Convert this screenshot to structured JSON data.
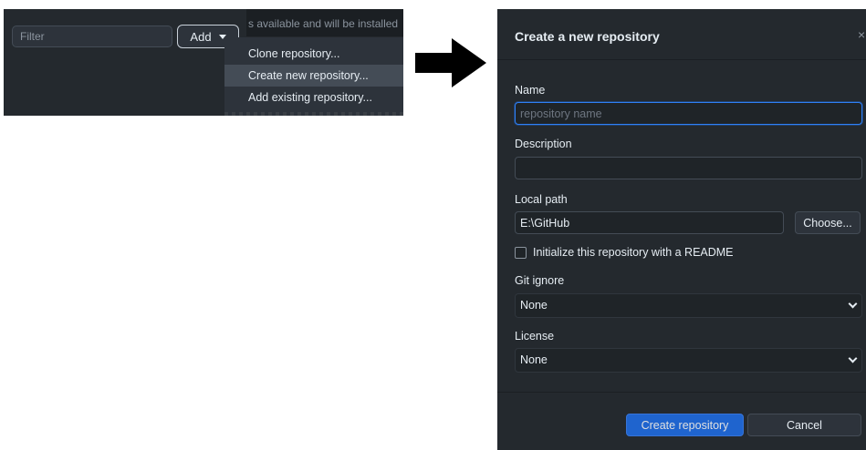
{
  "left": {
    "filter_placeholder": "Filter",
    "add_button_label": "Add",
    "banner_text": "s available and will be installed",
    "menu_items": [
      {
        "label": "Clone repository..."
      },
      {
        "label": "Create new repository..."
      },
      {
        "label": "Add existing repository..."
      }
    ]
  },
  "dialog": {
    "title": "Create a new repository",
    "close_glyph": "×",
    "name_label": "Name",
    "name_placeholder": "repository name",
    "name_value": "",
    "description_label": "Description",
    "description_value": "",
    "local_path_label": "Local path",
    "local_path_value": "E:\\GitHub",
    "choose_label": "Choose...",
    "readme_checkbox_label": "Initialize this repository with a README",
    "readme_checked": false,
    "gitignore_label": "Git ignore",
    "gitignore_value": "None",
    "license_label": "License",
    "license_value": "None",
    "create_label": "Create repository",
    "cancel_label": "Cancel"
  },
  "colors": {
    "background": "#24292e",
    "accent": "#1f6feb",
    "focus_border": "#2f81f7"
  },
  "icons": {
    "arrow": "right-arrow-icon",
    "caret": "caret-down-icon",
    "chevron": "chevron-down-icon",
    "close": "close-icon"
  }
}
